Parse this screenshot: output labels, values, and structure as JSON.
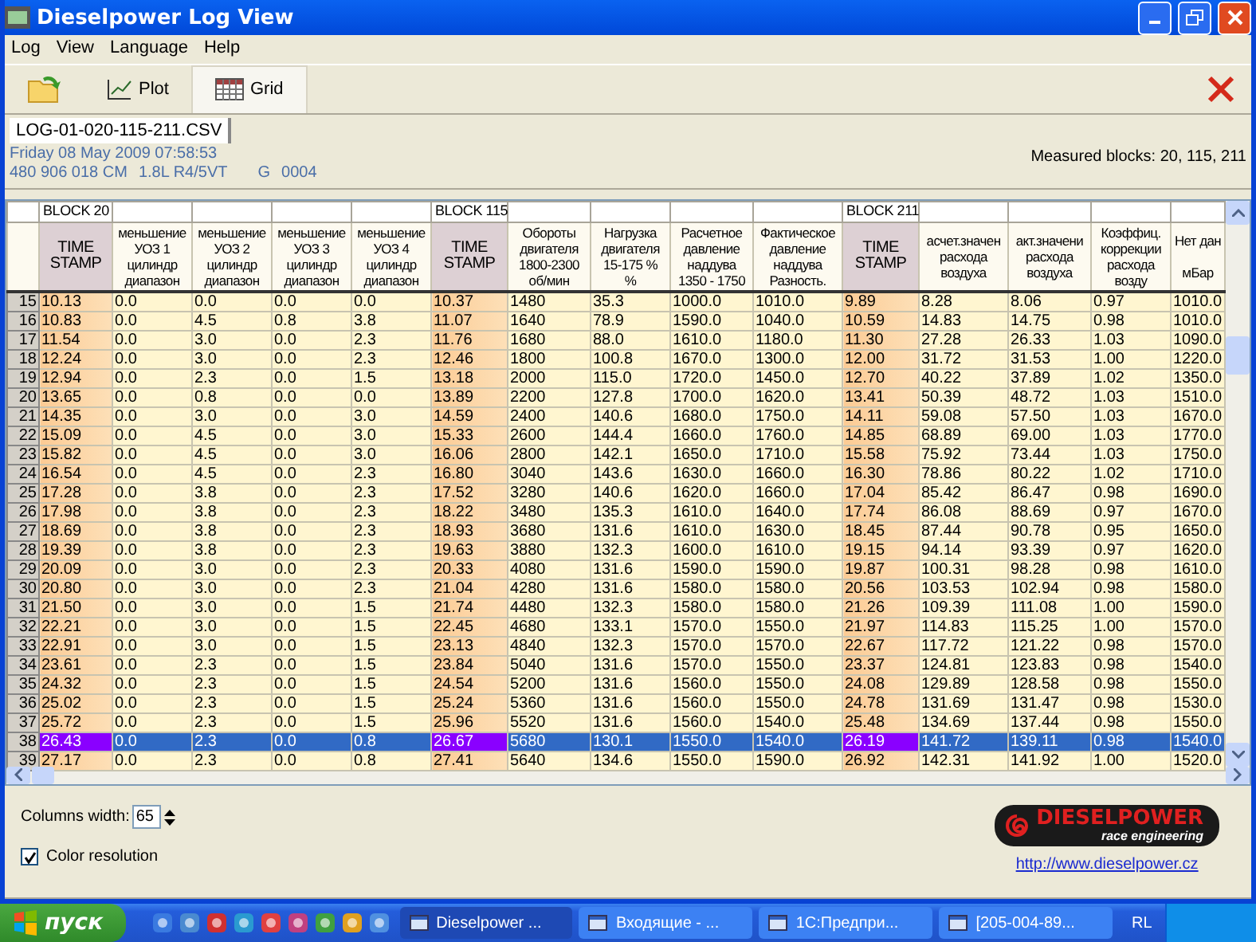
{
  "window": {
    "title": "Dieselpower Log View"
  },
  "menu": [
    "Log",
    "View",
    "Language",
    "Help"
  ],
  "toolbar": [
    {
      "kind": "open",
      "selected": false
    },
    {
      "kind": "plot",
      "label": "Plot",
      "selected": false
    },
    {
      "kind": "grid",
      "label": "Grid",
      "selected": true
    },
    {
      "kind": "close",
      "selected": false
    }
  ],
  "file_tabs": [
    {
      "label": "LOG-01-020-115-211.CSV",
      "selected": true
    }
  ],
  "info": {
    "date": "Friday 08 May 2009 07:58:53",
    "ecu": [
      "480 906 018 CM",
      "1.8L R4/5VT",
      "G",
      "0004"
    ],
    "measured_blocks": "Measured blocks: 20, 115, 211"
  },
  "grid": {
    "columns": [
      {
        "block": "BLOCK 20",
        "header": "TIME\nSTAMP",
        "kind": "timestamp"
      },
      {
        "header": "меньшение\nУОЗ 1\nцилиндр\nдиапазон",
        "kind": "value"
      },
      {
        "header": "меньшение\nУОЗ 2\nцилиндр\nдиапазон",
        "kind": "value"
      },
      {
        "header": "меньшение\nУОЗ 3\nцилиндр\nдиапазон",
        "kind": "value"
      },
      {
        "header": "меньшение\nУОЗ 4\nцилиндр\nдиапазон",
        "kind": "value"
      },
      {
        "block": "BLOCK 115",
        "header": "TIME\nSTAMP",
        "kind": "timestamp"
      },
      {
        "header": "Обороты\nдвигателя\n1800-2300\nоб/мин",
        "kind": "value"
      },
      {
        "header": "Нагрузка\nдвигателя\n15-175 %\n%",
        "kind": "value"
      },
      {
        "header": "Расчетное\nдавление\nнаддува\n1350 - 1750",
        "kind": "value"
      },
      {
        "header": "Фактическое\nдавление\nнаддува\nРазность.",
        "kind": "value"
      },
      {
        "block": "BLOCK 211",
        "header": "TIME\nSTAMP",
        "kind": "timestamp"
      },
      {
        "header": "асчет.значен\nрасхода\nвоздуха",
        "kind": "value"
      },
      {
        "header": "акт.значени\nрасхода\nвоздуха",
        "kind": "value"
      },
      {
        "header": "Коэффиц.\nкоррекции\nрасхода\nвозду",
        "kind": "value"
      },
      {
        "header": "Нет дан\n\nмБар",
        "kind": "value"
      }
    ],
    "rows": [
      {
        "number": "15",
        "selected": false,
        "cells": [
          "10.13",
          "0.0",
          "0.0",
          "0.0",
          "0.0",
          "10.37",
          "1480",
          "35.3",
          "1000.0",
          "1010.0",
          "9.89",
          "8.28",
          "8.06",
          "0.97",
          "1010.0"
        ]
      },
      {
        "number": "16",
        "selected": false,
        "cells": [
          "10.83",
          "0.0",
          "4.5",
          "0.8",
          "3.8",
          "11.07",
          "1640",
          "78.9",
          "1590.0",
          "1040.0",
          "10.59",
          "14.83",
          "14.75",
          "0.98",
          "1010.0"
        ]
      },
      {
        "number": "17",
        "selected": false,
        "cells": [
          "11.54",
          "0.0",
          "3.0",
          "0.0",
          "2.3",
          "11.76",
          "1680",
          "88.0",
          "1610.0",
          "1180.0",
          "11.30",
          "27.28",
          "26.33",
          "1.03",
          "1090.0"
        ]
      },
      {
        "number": "18",
        "selected": false,
        "cells": [
          "12.24",
          "0.0",
          "3.0",
          "0.0",
          "2.3",
          "12.46",
          "1800",
          "100.8",
          "1670.0",
          "1300.0",
          "12.00",
          "31.72",
          "31.53",
          "1.00",
          "1220.0"
        ]
      },
      {
        "number": "19",
        "selected": false,
        "cells": [
          "12.94",
          "0.0",
          "2.3",
          "0.0",
          "1.5",
          "13.18",
          "2000",
          "115.0",
          "1720.0",
          "1450.0",
          "12.70",
          "40.22",
          "37.89",
          "1.02",
          "1350.0"
        ]
      },
      {
        "number": "20",
        "selected": false,
        "cells": [
          "13.65",
          "0.0",
          "0.8",
          "0.0",
          "0.0",
          "13.89",
          "2200",
          "127.8",
          "1700.0",
          "1620.0",
          "13.41",
          "50.39",
          "48.72",
          "1.03",
          "1510.0"
        ]
      },
      {
        "number": "21",
        "selected": false,
        "cells": [
          "14.35",
          "0.0",
          "3.0",
          "0.0",
          "3.0",
          "14.59",
          "2400",
          "140.6",
          "1680.0",
          "1750.0",
          "14.11",
          "59.08",
          "57.50",
          "1.03",
          "1670.0"
        ]
      },
      {
        "number": "22",
        "selected": false,
        "cells": [
          "15.09",
          "0.0",
          "4.5",
          "0.0",
          "3.0",
          "15.33",
          "2600",
          "144.4",
          "1660.0",
          "1760.0",
          "14.85",
          "68.89",
          "69.00",
          "1.03",
          "1770.0"
        ]
      },
      {
        "number": "23",
        "selected": false,
        "cells": [
          "15.82",
          "0.0",
          "4.5",
          "0.0",
          "3.0",
          "16.06",
          "2800",
          "142.1",
          "1650.0",
          "1710.0",
          "15.58",
          "75.92",
          "73.44",
          "1.03",
          "1750.0"
        ]
      },
      {
        "number": "24",
        "selected": false,
        "cells": [
          "16.54",
          "0.0",
          "4.5",
          "0.0",
          "2.3",
          "16.80",
          "3040",
          "143.6",
          "1630.0",
          "1660.0",
          "16.30",
          "78.86",
          "80.22",
          "1.02",
          "1710.0"
        ]
      },
      {
        "number": "25",
        "selected": false,
        "cells": [
          "17.28",
          "0.0",
          "3.8",
          "0.0",
          "2.3",
          "17.52",
          "3280",
          "140.6",
          "1620.0",
          "1660.0",
          "17.04",
          "85.42",
          "86.47",
          "0.98",
          "1690.0"
        ]
      },
      {
        "number": "26",
        "selected": false,
        "cells": [
          "17.98",
          "0.0",
          "3.8",
          "0.0",
          "2.3",
          "18.22",
          "3480",
          "135.3",
          "1610.0",
          "1640.0",
          "17.74",
          "86.08",
          "88.69",
          "0.97",
          "1670.0"
        ]
      },
      {
        "number": "27",
        "selected": false,
        "cells": [
          "18.69",
          "0.0",
          "3.8",
          "0.0",
          "2.3",
          "18.93",
          "3680",
          "131.6",
          "1610.0",
          "1630.0",
          "18.45",
          "87.44",
          "90.78",
          "0.95",
          "1650.0"
        ]
      },
      {
        "number": "28",
        "selected": false,
        "cells": [
          "19.39",
          "0.0",
          "3.8",
          "0.0",
          "2.3",
          "19.63",
          "3880",
          "132.3",
          "1600.0",
          "1610.0",
          "19.15",
          "94.14",
          "93.39",
          "0.97",
          "1620.0"
        ]
      },
      {
        "number": "29",
        "selected": false,
        "cells": [
          "20.09",
          "0.0",
          "3.0",
          "0.0",
          "2.3",
          "20.33",
          "4080",
          "131.6",
          "1590.0",
          "1590.0",
          "19.87",
          "100.31",
          "98.28",
          "0.98",
          "1610.0"
        ]
      },
      {
        "number": "30",
        "selected": false,
        "cells": [
          "20.80",
          "0.0",
          "3.0",
          "0.0",
          "2.3",
          "21.04",
          "4280",
          "131.6",
          "1580.0",
          "1580.0",
          "20.56",
          "103.53",
          "102.94",
          "0.98",
          "1580.0"
        ]
      },
      {
        "number": "31",
        "selected": false,
        "cells": [
          "21.50",
          "0.0",
          "3.0",
          "0.0",
          "1.5",
          "21.74",
          "4480",
          "132.3",
          "1580.0",
          "1580.0",
          "21.26",
          "109.39",
          "111.08",
          "1.00",
          "1590.0"
        ]
      },
      {
        "number": "32",
        "selected": false,
        "cells": [
          "22.21",
          "0.0",
          "3.0",
          "0.0",
          "1.5",
          "22.45",
          "4680",
          "133.1",
          "1570.0",
          "1550.0",
          "21.97",
          "114.83",
          "115.25",
          "1.00",
          "1570.0"
        ]
      },
      {
        "number": "33",
        "selected": false,
        "cells": [
          "22.91",
          "0.0",
          "3.0",
          "0.0",
          "1.5",
          "23.13",
          "4840",
          "132.3",
          "1570.0",
          "1570.0",
          "22.67",
          "117.72",
          "121.22",
          "0.98",
          "1570.0"
        ]
      },
      {
        "number": "34",
        "selected": false,
        "cells": [
          "23.61",
          "0.0",
          "2.3",
          "0.0",
          "1.5",
          "23.84",
          "5040",
          "131.6",
          "1570.0",
          "1550.0",
          "23.37",
          "124.81",
          "123.83",
          "0.98",
          "1540.0"
        ]
      },
      {
        "number": "35",
        "selected": false,
        "cells": [
          "24.32",
          "0.0",
          "2.3",
          "0.0",
          "1.5",
          "24.54",
          "5200",
          "131.6",
          "1560.0",
          "1550.0",
          "24.08",
          "129.89",
          "128.58",
          "0.98",
          "1550.0"
        ]
      },
      {
        "number": "36",
        "selected": false,
        "cells": [
          "25.02",
          "0.0",
          "2.3",
          "0.0",
          "1.5",
          "25.24",
          "5360",
          "131.6",
          "1560.0",
          "1550.0",
          "24.78",
          "131.69",
          "131.47",
          "0.98",
          "1530.0"
        ]
      },
      {
        "number": "37",
        "selected": false,
        "cells": [
          "25.72",
          "0.0",
          "2.3",
          "0.0",
          "1.5",
          "25.96",
          "5520",
          "131.6",
          "1560.0",
          "1540.0",
          "25.48",
          "134.69",
          "137.44",
          "0.98",
          "1550.0"
        ]
      },
      {
        "number": "38",
        "selected": true,
        "cells": [
          "26.43",
          "0.0",
          "2.3",
          "0.0",
          "0.8",
          "26.67",
          "5680",
          "130.1",
          "1550.0",
          "1540.0",
          "26.19",
          "141.72",
          "139.11",
          "0.98",
          "1540.0"
        ]
      },
      {
        "number": "39",
        "selected": false,
        "cells": [
          "27.17",
          "0.0",
          "2.3",
          "0.0",
          "0.8",
          "27.41",
          "5640",
          "134.6",
          "1550.0",
          "1590.0",
          "26.92",
          "142.31",
          "141.92",
          "1.00",
          "1520.0"
        ]
      }
    ]
  },
  "footer": {
    "columns_width": {
      "label": "Columns width:",
      "value": "65"
    },
    "color_resolution": {
      "label": "Color resolution",
      "checked": true
    },
    "logo": {
      "name": "DIESELPOWER",
      "tagline": "race engineering"
    },
    "link": "http://www.dieselpower.cz"
  },
  "taskbar": {
    "start": "пуск",
    "tasks": [
      {
        "label": "Dieselpower ...",
        "selected": true
      },
      {
        "label": "Входящие - ...",
        "selected": false
      },
      {
        "label": "1С:Предпри...",
        "selected": false
      },
      {
        "label": "[205-004-89...",
        "selected": false
      }
    ],
    "language": "RL"
  }
}
